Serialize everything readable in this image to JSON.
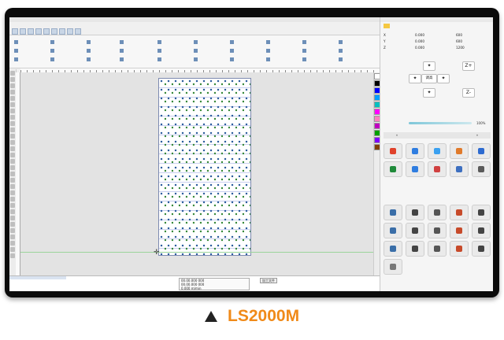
{
  "caption": {
    "label": "LS2000M"
  },
  "colors": {
    "accent": "#f08a19",
    "frame": "#0b0b0b",
    "sheet_border": "#7d8ab0"
  },
  "right_panel": {
    "axes": [
      {
        "name": "X",
        "value": "0.000",
        "max": "600"
      },
      {
        "name": "Y",
        "value": "0.000",
        "max": "600"
      },
      {
        "name": "Z",
        "value": "0.000",
        "max": "1200"
      }
    ],
    "jog": {
      "center": "调高"
    },
    "speed_percent": "100%"
  },
  "status": {
    "coords": [
      "00.00.000 000",
      "00.00.000 000"
    ],
    "speed_readout": "0.000 m/min",
    "process_button": "加工文件"
  },
  "palette_colors": [
    "#ffffff",
    "#000000",
    "#0000ff",
    "#00a0ff",
    "#00c0c0",
    "#ff00ff",
    "#ff80c0",
    "#c000c0",
    "#00a000",
    "#8000ff",
    "#804000"
  ]
}
